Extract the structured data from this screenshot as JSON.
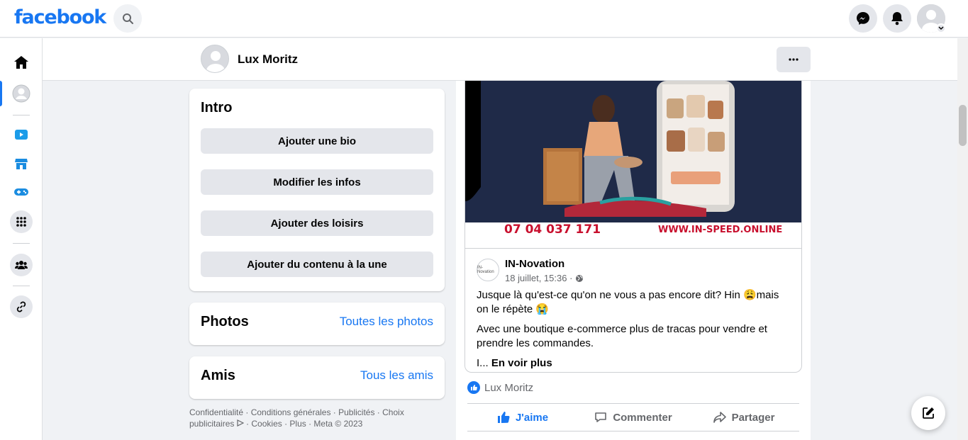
{
  "topbar": {
    "logo": "facebook"
  },
  "profile_header": {
    "name": "Lux Moritz"
  },
  "intro": {
    "title": "Intro",
    "buttons": [
      "Ajouter une bio",
      "Modifier les infos",
      "Ajouter des loisirs",
      "Ajouter du contenu à la une"
    ]
  },
  "photos": {
    "title": "Photos",
    "link": "Toutes les photos"
  },
  "friends": {
    "title": "Amis",
    "link": "Tous les amis"
  },
  "footer": {
    "line1": "Confidentialité · Conditions générales · Publicités · Choix",
    "line2a": "publicitaires",
    "line2b": " · Cookies · Plus · Meta © 2023"
  },
  "post": {
    "image_phone": "07 04 037 171",
    "image_website": "WWW.IN-SPEED.ONLINE",
    "page_avatar_text": "IN-Novation",
    "page_name": "IN-Novation",
    "date": "18 juillet, 15:36 ·",
    "paragraph1": "Jusque là qu'est-ce qu'on ne vous a pas encore dit? Hin 😩mais on le répète 😭",
    "paragraph2": "Avec une boutique e-commerce plus de tracas pour vendre et prendre les commandes.",
    "ellipsis": "I...",
    "see_more": "En voir plus",
    "reactor": "Lux Moritz",
    "actions": {
      "like": "J'aime",
      "comment": "Commenter",
      "share": "Partager"
    }
  },
  "colors": {
    "brand": "#1877f2",
    "background": "#f0f2f5",
    "button": "#e4e6eb"
  }
}
